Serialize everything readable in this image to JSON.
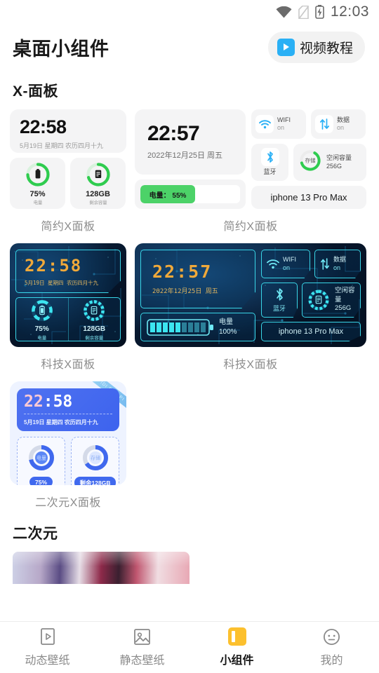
{
  "status_bar": {
    "time": "12:03",
    "icons": [
      "wifi-icon",
      "sim-off-icon",
      "battery-charging-icon"
    ]
  },
  "header": {
    "title": "桌面小组件",
    "tutorial_label": "视频教程",
    "tutorial_icon": "video-play-icon"
  },
  "sections": [
    {
      "title": "X-面板"
    },
    {
      "title": "二次元"
    }
  ],
  "widgets": {
    "simple_small": {
      "caption": "简约X面板",
      "time": "22:58",
      "date": "5月19日 星期四 农历四月十九",
      "battery": {
        "value": "75%",
        "label": "电量",
        "percent": 75
      },
      "storage": {
        "value": "128GB",
        "label": "剩余容量",
        "percent": 70
      }
    },
    "simple_wide": {
      "caption": "简约X面板",
      "time": "22:57",
      "date": "2022年12月25日 周五",
      "battery_bar": {
        "text": "电量： 55%",
        "percent": 55
      },
      "wifi": {
        "label": "WIFI",
        "state": "on"
      },
      "data": {
        "label": "数据",
        "state": "on"
      },
      "bluetooth": {
        "label": "蓝牙"
      },
      "storage": {
        "ring_label": "存储",
        "title": "空闲容量",
        "value": "256G",
        "percent": 62
      },
      "device": "iphone 13 Pro Max"
    },
    "tech_small": {
      "caption": "科技X面板",
      "time": "22:58",
      "date": "5月19日 星期四 农历四月十九",
      "battery": {
        "value": "75%",
        "label": "电量",
        "percent": 75
      },
      "storage": {
        "value": "128GB",
        "label": "剩余容量",
        "percent": 70
      }
    },
    "tech_wide": {
      "caption": "科技X面板",
      "time": "22:57",
      "date": "2022年12月25日 周五",
      "battery_label": "电量",
      "battery_value": "100%",
      "battery_percent": 100,
      "wifi": {
        "label": "WIFI",
        "state": "on"
      },
      "data": {
        "label": "数据",
        "state": "on"
      },
      "bluetooth": {
        "label": "蓝牙"
      },
      "storage": {
        "title": "空闲容量",
        "value": "256G",
        "percent": 70
      },
      "device": "iphone 13 Pro Max"
    },
    "anime": {
      "caption": "二次元X面板",
      "time_hh": "22",
      "time_sep": ":",
      "time_mm": "58",
      "date": "5月19日 星期四 农历四月十九",
      "ribbon": "PIDI PIDI PI",
      "battery": {
        "ring_label": "电量",
        "pill": "75%",
        "percent": 72
      },
      "storage": {
        "ring_label": "存储",
        "pill": "剩余128GB",
        "percent": 66
      }
    }
  },
  "bottom_nav": {
    "items": [
      {
        "label": "动态壁纸",
        "icon": "video-wallpaper-icon",
        "active": false
      },
      {
        "label": "静态壁纸",
        "icon": "image-wallpaper-icon",
        "active": false
      },
      {
        "label": "小组件",
        "icon": "widget-icon",
        "active": true
      },
      {
        "label": "我的",
        "icon": "profile-icon",
        "active": false
      }
    ]
  },
  "colors": {
    "accent_green": "#2fcc4f",
    "accent_blue": "#2ab0f5",
    "nav_active": "#fcc02e",
    "tech_cyan": "#39d6e8",
    "tech_amber": "#f0a93a",
    "anime_blue": "#4069ee"
  }
}
